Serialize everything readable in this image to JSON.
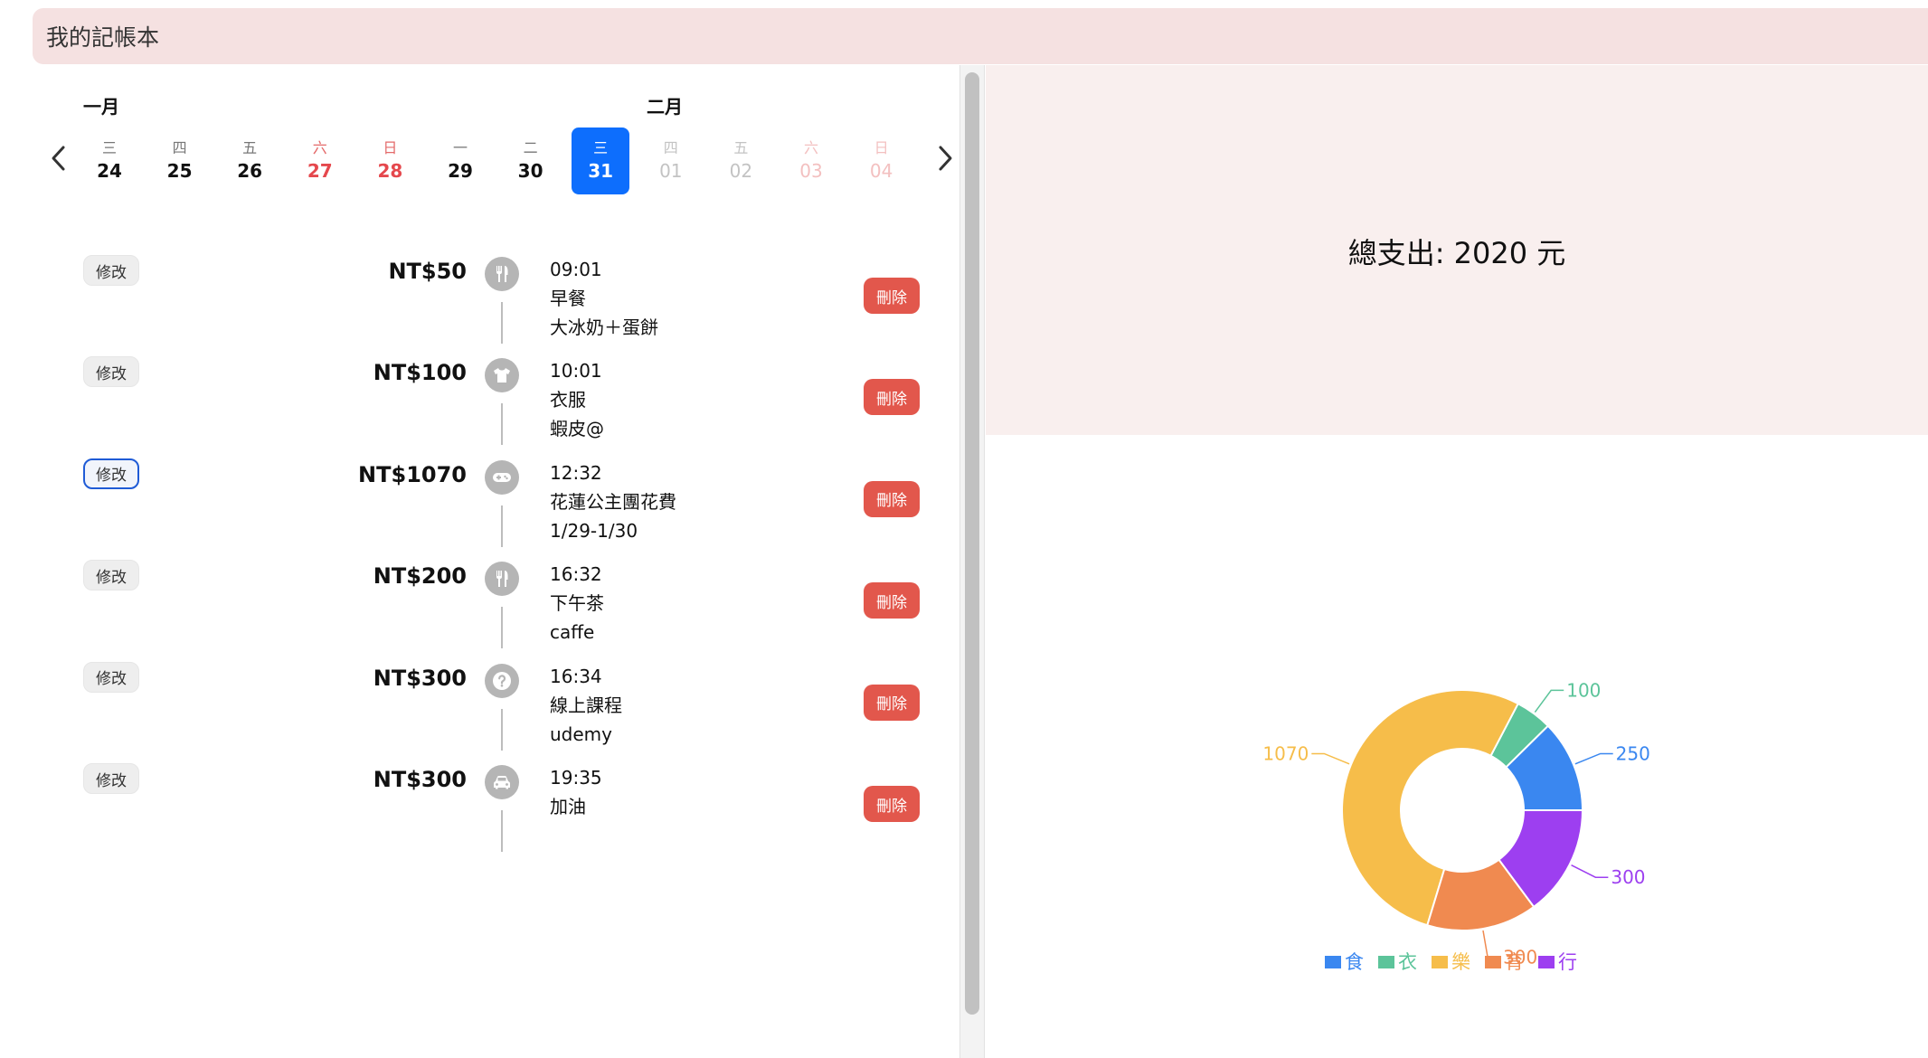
{
  "app": {
    "title": "我的記帳本"
  },
  "calendar": {
    "months": [
      {
        "label": "一月"
      },
      {
        "label": "二月"
      }
    ],
    "days": [
      {
        "weekday": "三",
        "day": "24",
        "style": "normal"
      },
      {
        "weekday": "四",
        "day": "25",
        "style": "normal"
      },
      {
        "weekday": "五",
        "day": "26",
        "style": "normal"
      },
      {
        "weekday": "六",
        "day": "27",
        "style": "weekend"
      },
      {
        "weekday": "日",
        "day": "28",
        "style": "weekend"
      },
      {
        "weekday": "一",
        "day": "29",
        "style": "normal"
      },
      {
        "weekday": "二",
        "day": "30",
        "style": "normal"
      },
      {
        "weekday": "三",
        "day": "31",
        "style": "selected"
      },
      {
        "weekday": "四",
        "day": "01",
        "style": "faded"
      },
      {
        "weekday": "五",
        "day": "02",
        "style": "faded"
      },
      {
        "weekday": "六",
        "day": "03",
        "style": "faded-weekend"
      },
      {
        "weekday": "日",
        "day": "04",
        "style": "faded-weekend"
      }
    ],
    "selected_day": "31"
  },
  "entries": [
    {
      "edit_label": "修改",
      "amount": "NT$50",
      "icon": "utensils-icon",
      "time": "09:01",
      "title": "早餐",
      "note": "大冰奶＋蛋餅",
      "delete_label": "刪除"
    },
    {
      "edit_label": "修改",
      "amount": "NT$100",
      "icon": "tshirt-icon",
      "time": "10:01",
      "title": "衣服",
      "note": "蝦皮@",
      "delete_label": "刪除"
    },
    {
      "edit_label": "修改",
      "amount": "NT$1070",
      "icon": "gamepad-icon",
      "time": "12:32",
      "title": "花蓮公主團花費",
      "note": "1/29-1/30",
      "delete_label": "刪除",
      "focused": true
    },
    {
      "edit_label": "修改",
      "amount": "NT$200",
      "icon": "utensils-icon",
      "time": "16:32",
      "title": "下午茶",
      "note": "caffe",
      "delete_label": "刪除"
    },
    {
      "edit_label": "修改",
      "amount": "NT$300",
      "icon": "question-icon",
      "time": "16:34",
      "title": "線上課程",
      "note": "udemy",
      "delete_label": "刪除"
    },
    {
      "edit_label": "修改",
      "amount": "NT$300",
      "icon": "car-icon",
      "time": "19:35",
      "title": "加油",
      "note": "",
      "delete_label": "刪除"
    }
  ],
  "summary": {
    "total_text": "總支出: 2020 元"
  },
  "chart_data": {
    "type": "pie",
    "subtype": "donut",
    "categories": [
      "食",
      "衣",
      "樂",
      "育",
      "行"
    ],
    "values": [
      250,
      100,
      1070,
      300,
      300
    ],
    "colors": [
      "#3a87f0",
      "#5cc49a",
      "#f6bd4a",
      "#f08a50",
      "#9d3ff0"
    ],
    "legend_position": "bottom"
  }
}
